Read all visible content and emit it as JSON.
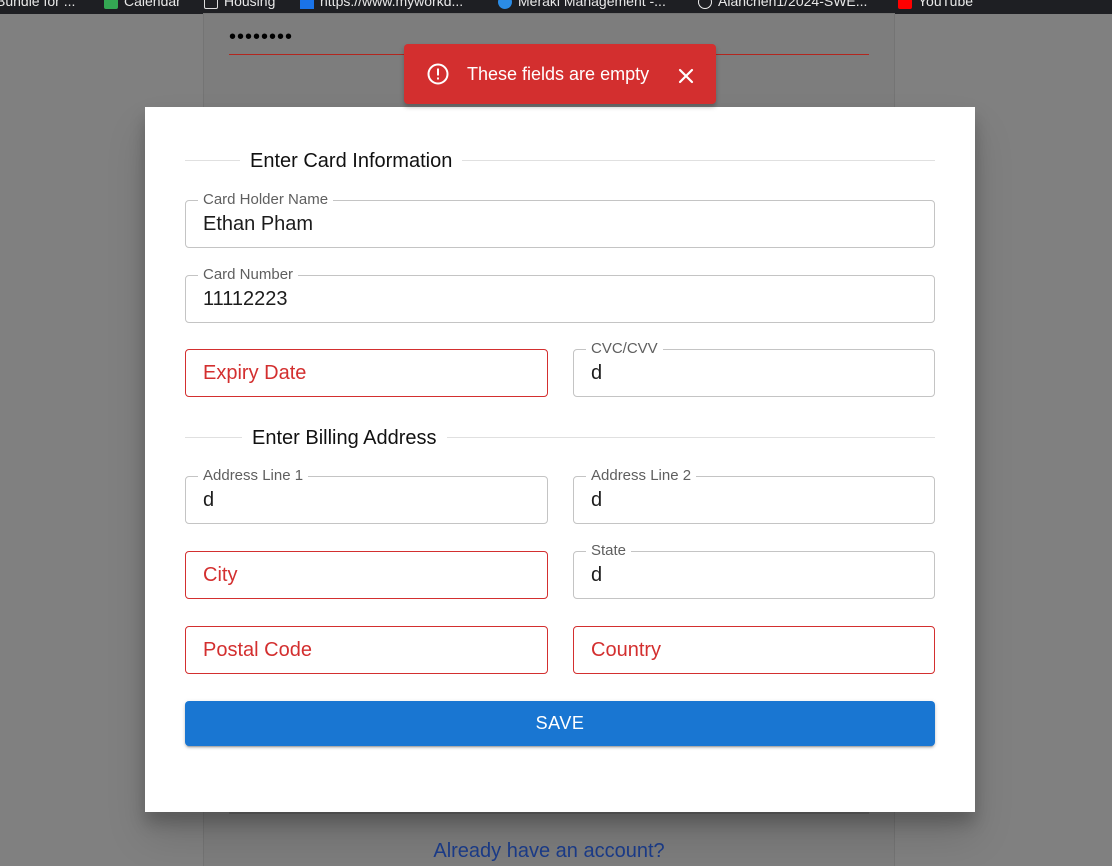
{
  "bookmarks": [
    {
      "label": "Bundle for ..."
    },
    {
      "label": "Calendar"
    },
    {
      "label": "Housing"
    },
    {
      "label": "https://www.myworkd..."
    },
    {
      "label": "Meraki Management -..."
    },
    {
      "label": "Alanchen1/2024-SWE..."
    },
    {
      "label": "YouTube"
    }
  ],
  "background_page": {
    "password_mask": "••••••••",
    "signin_link": "Already have an account?"
  },
  "toast": {
    "message": "These fields are empty",
    "color": "#d32f2f"
  },
  "modal": {
    "card_section_title": "Enter Card Information",
    "billing_section_title": "Enter Billing Address",
    "fields": {
      "card_holder_name": {
        "label": "Card Holder Name",
        "value": "Ethan Pham"
      },
      "card_number": {
        "label": "Card Number",
        "value": "11112223"
      },
      "expiry_date": {
        "placeholder": "Expiry Date",
        "error": true
      },
      "cvc": {
        "label": "CVC/CVV",
        "value": "d"
      },
      "address_line_1": {
        "label": "Address Line 1",
        "value": "d"
      },
      "address_line_2": {
        "label": "Address Line 2",
        "value": "d"
      },
      "city": {
        "placeholder": "City",
        "error": true
      },
      "state": {
        "label": "State",
        "value": "d"
      },
      "postal_code": {
        "placeholder": "Postal Code",
        "error": true
      },
      "country": {
        "placeholder": "Country",
        "error": true
      }
    },
    "save_label": "SAVE",
    "accent_color": "#1976d2",
    "error_color": "#d32f2f"
  }
}
